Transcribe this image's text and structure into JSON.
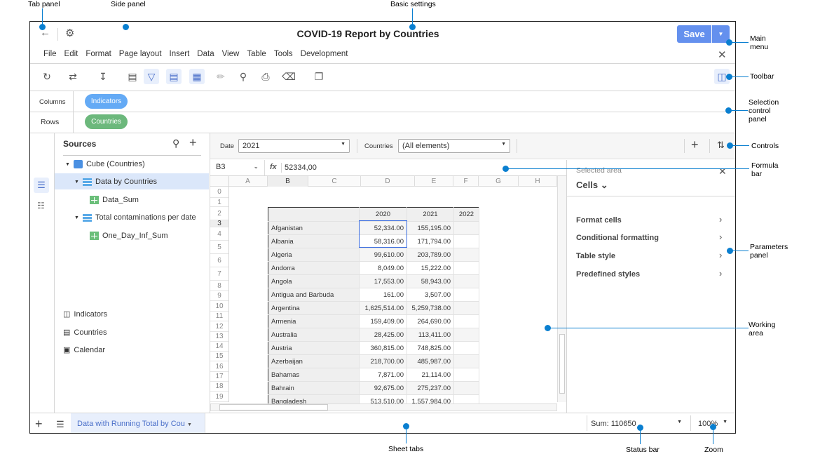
{
  "header": {
    "title": "COVID-19 Report by Countries",
    "save_label": "Save",
    "back_icon": "arrow-left-icon",
    "settings_icon": "gear-icon"
  },
  "menu": {
    "items": [
      "File",
      "Edit",
      "Format",
      "Page layout",
      "Insert",
      "Data",
      "View",
      "Table",
      "Tools",
      "Development"
    ]
  },
  "selection": {
    "columns_label": "Columns",
    "rows_label": "Rows",
    "columns_pill": "Indicators",
    "rows_pill": "Countries",
    "columns_color": "#64aaf5",
    "rows_color": "#6cb87c"
  },
  "sources": {
    "title": "Sources",
    "tree": [
      {
        "label": "Cube (Countries)"
      },
      {
        "label": "Data by Countries",
        "selected": true
      },
      {
        "label": "Data_Sum"
      },
      {
        "label": "Total contaminations per date"
      },
      {
        "label": "One_Day_Inf_Sum"
      }
    ],
    "dimensions": [
      "Indicators",
      "Countries",
      "Calendar"
    ]
  },
  "controls": {
    "date_label": "Date",
    "date_value": "2021",
    "countries_label": "Countries",
    "countries_value": "(All elements)"
  },
  "formula": {
    "cell": "B3",
    "fx": "fx",
    "value": "52334,00"
  },
  "grid": {
    "columns": [
      "A",
      "B",
      "C",
      "D",
      "E",
      "F",
      "G",
      "H"
    ],
    "rows": [
      "0",
      "1",
      "2",
      "3",
      "4",
      "5",
      "6",
      "7",
      "8",
      "9",
      "10",
      "11",
      "12",
      "13",
      "14",
      "15",
      "16",
      "17",
      "18",
      "19"
    ]
  },
  "table": {
    "headers": [
      "",
      "2020",
      "2021",
      "2022"
    ],
    "rows": [
      [
        "Afganistan",
        "52,334.00",
        "155,195.00",
        ""
      ],
      [
        "Albania",
        "58,316.00",
        "171,794.00",
        ""
      ],
      [
        "Algeria",
        "99,610.00",
        "203,789.00",
        ""
      ],
      [
        "Andorra",
        "8,049.00",
        "15,222.00",
        ""
      ],
      [
        "Angola",
        "17,553.00",
        "58,943.00",
        ""
      ],
      [
        "Antigua and Barbuda",
        "161.00",
        "3,507.00",
        ""
      ],
      [
        "Argentina",
        "1,625,514.00",
        "5,259,738.00",
        ""
      ],
      [
        "Armenia",
        "159,409.00",
        "264,690.00",
        ""
      ],
      [
        "Australia",
        "28,425.00",
        "113,411.00",
        ""
      ],
      [
        "Austria",
        "360,815.00",
        "748,825.00",
        ""
      ],
      [
        "Azerbaijan",
        "218,700.00",
        "485,987.00",
        ""
      ],
      [
        "Bahamas",
        "7,871.00",
        "21,114.00",
        ""
      ],
      [
        "Bahrain",
        "92,675.00",
        "275,237.00",
        ""
      ],
      [
        "Bangladesh",
        "513,510.00",
        "1,557,984.00",
        ""
      ]
    ]
  },
  "params": {
    "subtitle": "Selected area",
    "title": "Cells",
    "items": [
      "Format cells",
      "Conditional formatting",
      "Table style",
      "Predefined styles"
    ]
  },
  "bottom": {
    "sheet_tab": "Data with Running Total by Cou",
    "status": "Sum: 110650",
    "zoom": "100%"
  },
  "annotations": {
    "tab_panel": "Tab panel",
    "side_panel": "Side panel",
    "basic_settings": "Basic settings",
    "main_menu": "Main menu",
    "toolbar": "Toolbar",
    "selection_control_panel": "Selection control panel",
    "controls": "Controls",
    "formula_bar": "Formula bar",
    "parameters_panel": "Parameters panel",
    "working_area": "Working area",
    "sheet_tabs": "Sheet tabs",
    "status_bar": "Status bar",
    "zoom": "Zoom"
  }
}
